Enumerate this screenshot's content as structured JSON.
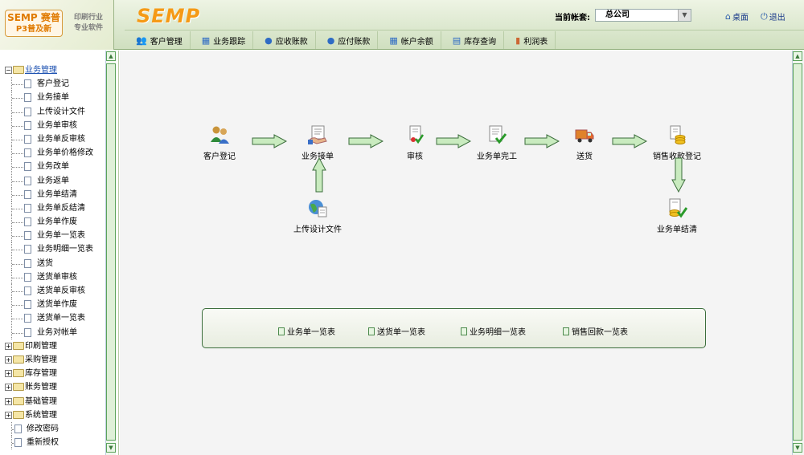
{
  "header": {
    "logo_main_line1": "SEMP 赛普",
    "logo_main_line2": "P3普及新",
    "logo_side_line1": "印刷行业",
    "logo_side_line2": "专业软件",
    "brand": "SEMP",
    "account_label": "当前帐套:",
    "account_value": "总公司",
    "desktop_link": "桌面",
    "exit_link": "退出"
  },
  "menu": [
    {
      "label": "客户管理",
      "icon": "users-icon"
    },
    {
      "label": "业务跟踪",
      "icon": "chart-icon"
    },
    {
      "label": "应收账款",
      "icon": "money-icon"
    },
    {
      "label": "应付账款",
      "icon": "money-icon"
    },
    {
      "label": "帐户余额",
      "icon": "chart-icon"
    },
    {
      "label": "库存查询",
      "icon": "box-icon"
    },
    {
      "label": "利润表",
      "icon": "bar-icon"
    }
  ],
  "tree": {
    "root": "业务管理",
    "children": [
      "客户登记",
      "业务接单",
      "上传设计文件",
      "业务单审核",
      "业务单反审核",
      "业务单价格修改",
      "业务改单",
      "业务返单",
      "业务单结清",
      "业务单反结清",
      "业务单作废",
      "业务单一览表",
      "业务明细一览表",
      "送货",
      "送货单审核",
      "送货单反审核",
      "送货单作废",
      "送货单一览表",
      "业务对帐单"
    ],
    "folders": [
      "印刷管理",
      "采购管理",
      "库存管理",
      "账务管理",
      "基础管理",
      "系统管理"
    ],
    "bottom_items": [
      "修改密码",
      "重新授权"
    ]
  },
  "flow": {
    "customer_register": "客户登记",
    "order_receive": "业务接单",
    "upload_design": "上传设计文件",
    "review": "审核",
    "order_complete": "业务单完工",
    "delivery": "送货",
    "sales_receipt": "销售收款登记",
    "order_settle": "业务单结清"
  },
  "reports": [
    "业务单一览表",
    "送货单一览表",
    "业务明细一览表",
    "销售回款一览表"
  ],
  "colors": {
    "brand": "#f59a16",
    "accent": "#3c6e3c",
    "arrow_fill": "#c9ebbf"
  }
}
